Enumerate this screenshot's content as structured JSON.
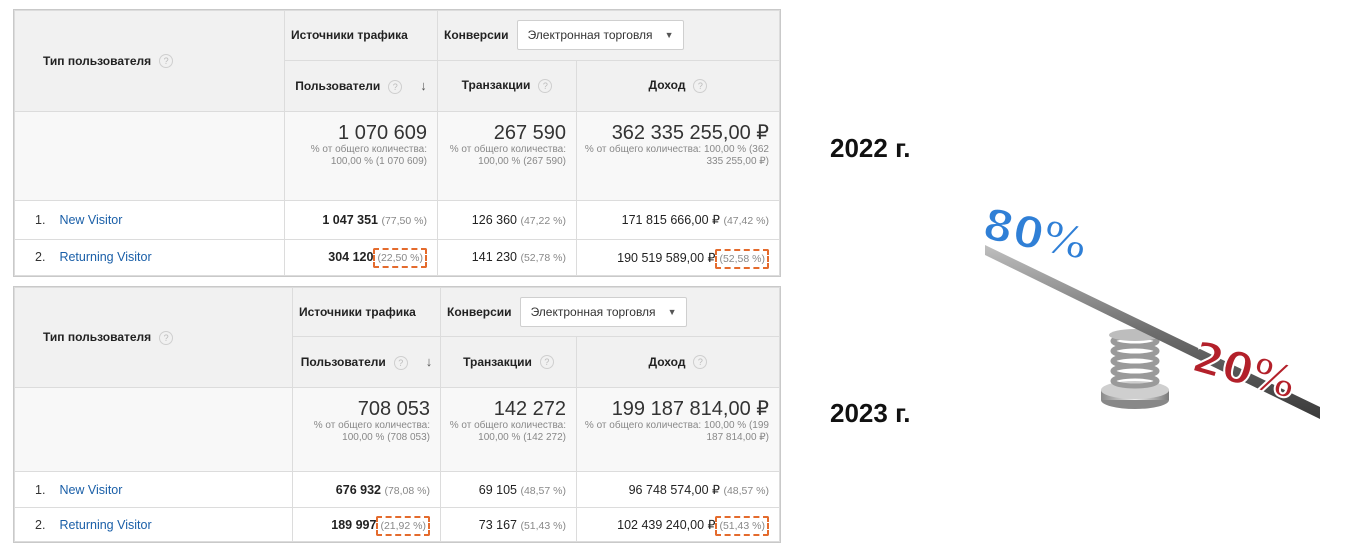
{
  "header": {
    "user_type": "Тип пользователя",
    "traffic_sources": "Источники трафика",
    "conversions": "Конверсии",
    "conversion_select": "Электронная торговля",
    "users": "Пользователи",
    "transactions": "Транзакции",
    "revenue": "Доход",
    "help": "?",
    "sort": "↓",
    "caret": "▼"
  },
  "reports": [
    {
      "year": "2022 г.",
      "totals": {
        "users": "1 070 609",
        "users_sub": "% от общего количества: 100,00 % (1 070 609)",
        "transactions": "267 590",
        "transactions_sub": "% от общего количества: 100,00 % (267 590)",
        "revenue": "362 335 255,00 ₽",
        "revenue_sub": "% от общего количества: 100,00 % (362 335 255,00 ₽)"
      },
      "rows": [
        {
          "idx": "1.",
          "name": "New Visitor",
          "users": "1 047 351",
          "users_pct": "(77,50 %)",
          "transactions": "126 360",
          "transactions_pct": "(47,22 %)",
          "revenue": "171 815 666,00 ₽",
          "revenue_pct": "(47,42 %)"
        },
        {
          "idx": "2.",
          "name": "Returning Visitor",
          "users": "304 120",
          "users_pct": "(22,50 %)",
          "transactions": "141 230",
          "transactions_pct": "(52,78 %)",
          "revenue": "190 519 589,00 ₽",
          "revenue_pct": "(52,58 %)"
        }
      ]
    },
    {
      "year": "2023 г.",
      "totals": {
        "users": "708 053",
        "users_sub": "% от общего количества: 100,00 % (708 053)",
        "transactions": "142 272",
        "transactions_sub": "% от общего количества: 100,00 % (142 272)",
        "revenue": "199 187 814,00 ₽",
        "revenue_sub": "% от общего количества: 100,00 % (199 187 814,00 ₽)"
      },
      "rows": [
        {
          "idx": "1.",
          "name": "New Visitor",
          "users": "676 932",
          "users_pct": "(78,08 %)",
          "transactions": "69 105",
          "transactions_pct": "(48,57 %)",
          "revenue": "96 748 574,00 ₽",
          "revenue_pct": "(48,57 %)"
        },
        {
          "idx": "2.",
          "name": "Returning Visitor",
          "users": "189 997",
          "users_pct": "(21,92 %)",
          "transactions": "73 167",
          "transactions_pct": "(51,43 %)",
          "revenue": "102 439 240,00 ₽",
          "revenue_pct": "(51,43 %)"
        }
      ]
    }
  ],
  "illustration": {
    "label_high": "80%",
    "label_low": "20%"
  },
  "colors": {
    "link": "#1a5fa8",
    "highlight": "#e46b2d",
    "blue": "#2f7fd6",
    "red": "#b3202a"
  }
}
